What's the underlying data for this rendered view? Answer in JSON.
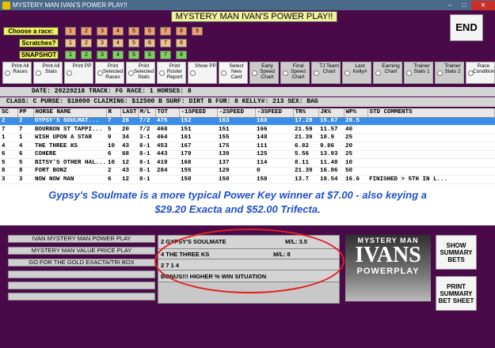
{
  "window": {
    "title": "MYSTERY MAN IVAN'S POWER PLAY!!",
    "minimize": "–",
    "maximize": "□",
    "close": "✕"
  },
  "main_title": "MYSTERY MAN IVAN'S POWER PLAY!!",
  "end_label": "END",
  "choose_race_label": "Choose a race:",
  "scratches_label": "Scratches?",
  "snapshot_label": "SNAPSHOT",
  "race_numbers": [
    "1",
    "2",
    "3",
    "4",
    "5",
    "6",
    "7",
    "8",
    "9"
  ],
  "scratch_numbers": [
    "1",
    "2",
    "3",
    "4",
    "5",
    "6",
    "7",
    "8"
  ],
  "snapshot_numbers": [
    "1",
    "2",
    "3",
    "4",
    "5",
    "6",
    "7",
    "8"
  ],
  "tools": [
    {
      "label": "Print All Races"
    },
    {
      "label": "Print All Stats"
    },
    {
      "label": "Print PP"
    },
    {
      "label": "Print Selected Races"
    },
    {
      "label": "Print Selected Stats"
    },
    {
      "label": "Print Roster Report"
    },
    {
      "label": "Show PP"
    },
    {
      "label": "Select New Card"
    },
    {
      "label": "Early Speed Chart"
    },
    {
      "label": "Final Speed Chart"
    },
    {
      "label": "TJ Team Chart"
    },
    {
      "label": "Last Kelly#"
    },
    {
      "label": "Earning Chart"
    },
    {
      "label": "Trainer Stats 1"
    },
    {
      "label": "Trainer Stats 2"
    },
    {
      "label": "Race Conditions"
    }
  ],
  "info1": "DATE: 20220218     TRACK: FG          RACE: 1     HORSES: 8",
  "info2": "CLASS: C   PURSE: $18000  CLAIMING: $12500 B  SURF: DIRT B  FUR: 8   KELLY#: 213     SEX: BAG",
  "table": {
    "headers": [
      "SC",
      "PP",
      "HORSE NAME",
      "R",
      "LAST",
      "M/L",
      "TOT",
      "-1SPEED",
      "-2SPEED",
      "-3SPEED",
      "TR%",
      "JK%",
      "WP%",
      "STD COMMENTS"
    ],
    "rows": [
      [
        "2",
        "2",
        "GYPSY'S SOULMAT...",
        "7",
        "26",
        "7/2",
        "475",
        "152",
        "163",
        "160",
        "17.28",
        "15.67",
        "28.5",
        ""
      ],
      [
        "7",
        "7",
        "BOURBON ST TAPPI...",
        "5",
        "20",
        "7/2",
        "468",
        "151",
        "151",
        "166",
        "21.59",
        "11.57",
        "40",
        ""
      ],
      [
        "1",
        "1",
        "WISH UPON A STAR",
        "9",
        "34",
        "3-1",
        "464",
        "161",
        "155",
        "148",
        "21.39",
        "10.9",
        "25",
        ""
      ],
      [
        "4",
        "4",
        "THE THREE KS",
        "10",
        "43",
        "8-1",
        "453",
        "167",
        "175",
        "111",
        "6.82",
        "9.86",
        "20",
        ""
      ],
      [
        "6",
        "6",
        "COHERE",
        "6",
        "68",
        "8-1",
        "443",
        "179",
        "139",
        "125",
        "5.56",
        "13.93",
        "25",
        ""
      ],
      [
        "5",
        "5",
        "BITSY'S OTHER HAL...",
        "10",
        "12",
        "8-1",
        "419",
        "168",
        "137",
        "114",
        "8.11",
        "11.48",
        "10",
        ""
      ],
      [
        "8",
        "8",
        "FORT BONZ",
        "2",
        "43",
        "8-1",
        "284",
        "155",
        "129",
        "0",
        "21.39",
        "16.86",
        "50",
        ""
      ],
      [
        "3",
        "3",
        "NOW NOW MAN",
        "6",
        "12",
        "8-1",
        "",
        "150",
        "150",
        "158",
        "13.7",
        "18.54",
        "16.6",
        "FINISHED > 5TH IN L..."
      ]
    ]
  },
  "comment": "Gypsy's Soulmate is a more typical Power Key winner at $7.00 - also keying a $29.20 Exacta and $52.00 Trifecta.",
  "left_labels": [
    "IVAN MYSTERY MAN POWER PLAY",
    "MYSTERY MAN VALUE PRICE PLAY",
    "GO FOR THE GOLD EXACTA/TRI BOX",
    "",
    "",
    ""
  ],
  "middle": {
    "line1_name": "2   GYPSY'S SOULMATE",
    "line1_ml": "M/L:  3.5",
    "line2_name": "4   THE THREE KS",
    "line2_ml": "M/L:  8",
    "line3": "2   7   1   4",
    "line4": "BONUS!!! HIGHER % WIN SITUATION"
  },
  "logo": {
    "line1": "MYSTERY MAN",
    "line2": "IVANS",
    "line3": "POWERPLAY"
  },
  "show_summary_label": "SHOW SUMMARY BETS",
  "print_summary_label": "PRINT SUMMARY BET SHEET",
  "colors": {
    "background": "#4a0a4a",
    "selected_row": "#3a8ee8",
    "comment_text": "#2050c8",
    "highlight_oval": "#e02020"
  }
}
